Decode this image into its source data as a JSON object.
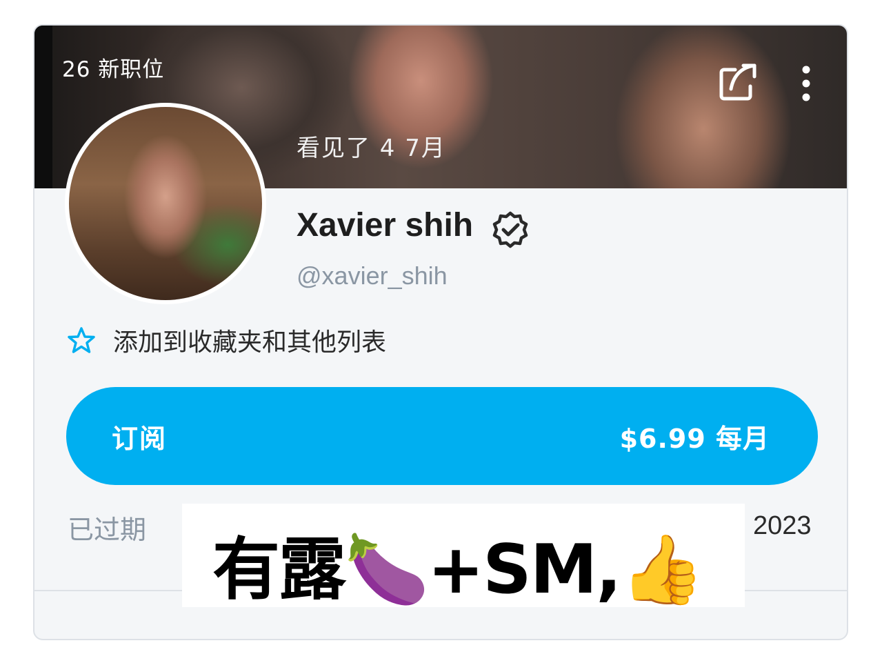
{
  "header": {
    "new_posts": "26 新职位",
    "last_seen": "看见了 4 7月",
    "share_icon": "share-icon",
    "more_icon": "more-vertical-icon"
  },
  "profile": {
    "display_name": "Xavier shih",
    "handle": "@xavier_shih",
    "verified_icon": "verified-badge-icon"
  },
  "favorites": {
    "icon": "star-outline-icon",
    "label": "添加到收藏夹和其他列表"
  },
  "subscribe": {
    "label": "订阅",
    "price": "$6.99 每月",
    "color": "#00aff0"
  },
  "status": {
    "expired_label": "已过期",
    "year": "2023"
  },
  "overlay": {
    "caption": "有露🍆+SM,👍"
  }
}
